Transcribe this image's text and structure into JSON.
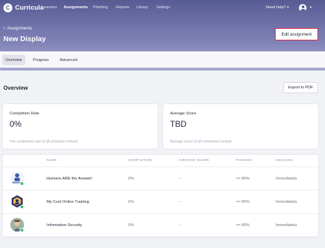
{
  "app": {
    "name": "Curricula",
    "logo_letter": "C"
  },
  "nav": {
    "items": [
      "Learners",
      "Assignments",
      "Phishing",
      "Reports",
      "Library",
      "Settings"
    ],
    "active": "Assignments",
    "help_label": "Need help?"
  },
  "breadcrumb": {
    "back_label": "Assignments"
  },
  "page": {
    "title": "New Display",
    "edit_button": "Edit assignment"
  },
  "tabs": [
    "Overview",
    "Progress",
    "Advanced"
  ],
  "overview": {
    "title": "Overview",
    "export_button": "Export to PDF"
  },
  "stats": [
    {
      "label": "Completion Rate",
      "value": "0%",
      "description": "The completion rate of all unlocked content."
    },
    {
      "label": "Average Score",
      "value": "TBD",
      "description": "Average score of all completed content."
    }
  ],
  "table": {
    "columns": [
      "NAME",
      "COMPLETION",
      "AVERAGE SCORE",
      "PASSING",
      "UNLOCKS"
    ],
    "rows": [
      {
        "name": "Humans ARE the Answer!",
        "completion": "0%",
        "average_score": "--",
        "passing": ">= 80%",
        "unlocks": "Immediately",
        "thumb_icon": "humans-course-icon"
      },
      {
        "name": "My Cool Online Training",
        "completion": "0%",
        "average_score": "--",
        "passing": ">= 80%",
        "unlocks": "Immediately",
        "thumb_icon": "badge-course-icon"
      },
      {
        "name": "Information Security",
        "completion": "0%",
        "average_score": "--",
        "passing": ">= 80%",
        "unlocks": "Immediately",
        "thumb_icon": "photo-course-icon"
      }
    ]
  },
  "colors": {
    "accent": "#575b94",
    "edit_border": "#e0253c",
    "status_dot": "#2fbf71"
  }
}
